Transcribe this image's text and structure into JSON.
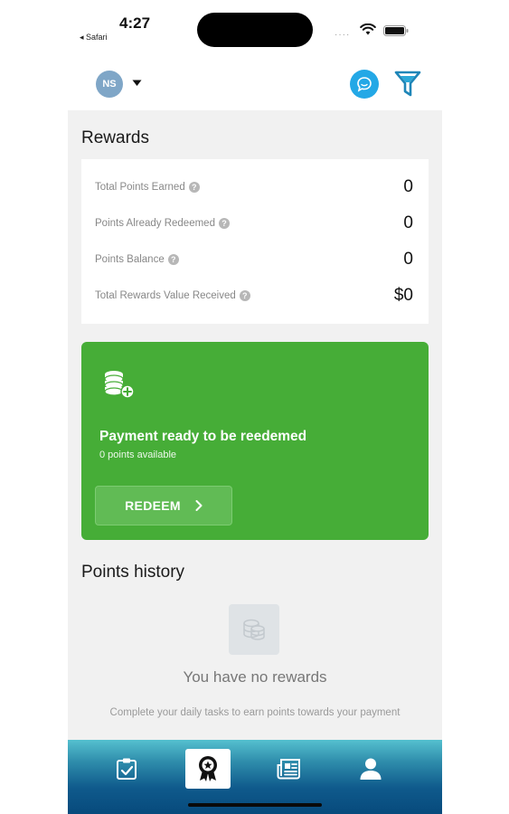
{
  "status_bar": {
    "time": "4:27",
    "back_label": "◂ Safari",
    "signal": "····"
  },
  "header": {
    "avatar_initials": "NS",
    "icons": [
      "chevron-down-icon",
      "chat-icon",
      "filter-icon"
    ]
  },
  "rewards": {
    "title": "Rewards",
    "stats": [
      {
        "label": "Total Points Earned",
        "value": "0"
      },
      {
        "label": "Points Already Redeemed",
        "value": "0"
      },
      {
        "label": "Points Balance",
        "value": "0"
      },
      {
        "label": "Total Rewards Value Received",
        "value": "$0"
      }
    ],
    "help_glyph": "?"
  },
  "payment_card": {
    "title": "Payment ready to be reedemed",
    "subtitle": "0 points available",
    "button_label": "REDEEM",
    "background_color": "#46ad37"
  },
  "points_history": {
    "title": "Points history",
    "empty_title": "You have no rewards",
    "empty_subtitle": "Complete your daily tasks to earn points towards your payment"
  },
  "tab_bar": {
    "tabs": [
      {
        "icon": "clipboard-check-icon",
        "active": false
      },
      {
        "icon": "award-badge-icon",
        "active": true
      },
      {
        "icon": "newspaper-icon",
        "active": false
      },
      {
        "icon": "user-icon",
        "active": false
      }
    ]
  }
}
